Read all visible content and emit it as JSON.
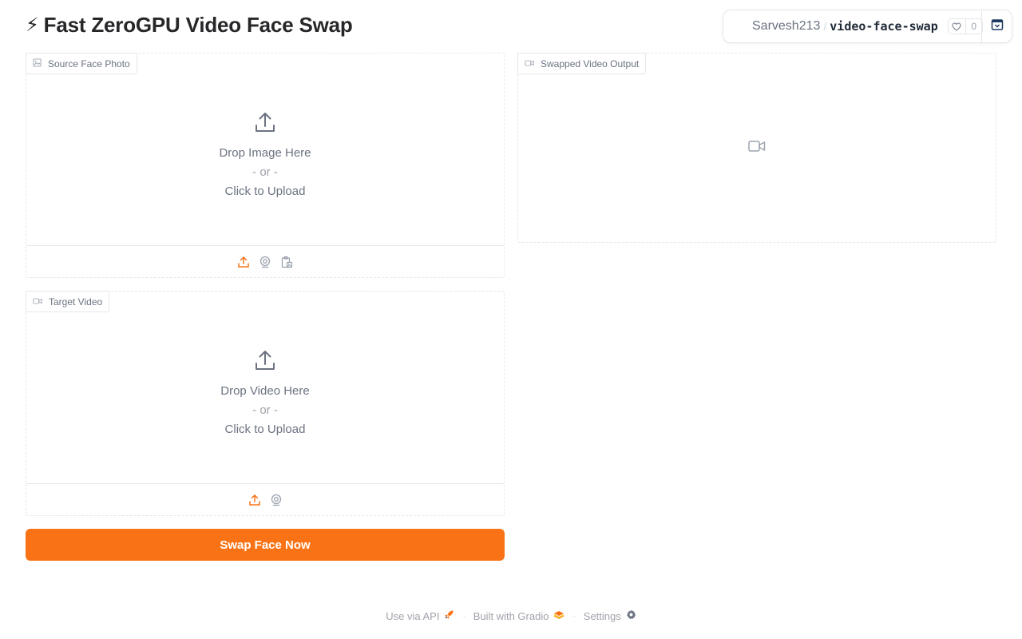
{
  "header": {
    "title_icon": "⚡",
    "title": "Fast ZeroGPU Video Face Swap"
  },
  "hf_badge": {
    "owner": "Sarvesh213",
    "separator": "/",
    "repo": "video-face-swap",
    "like_count": "0"
  },
  "source_panel": {
    "label": "Source Face Photo",
    "drop_text": "Drop Image Here",
    "or_text": "- or -",
    "upload_text": "Click to Upload"
  },
  "target_panel": {
    "label": "Target Video",
    "drop_text": "Drop Video Here",
    "or_text": "- or -",
    "upload_text": "Click to Upload"
  },
  "output_panel": {
    "label": "Swapped Video Output"
  },
  "swap_button": {
    "label": "Swap Face Now"
  },
  "footer": {
    "api": "Use via API",
    "built": "Built with Gradio",
    "settings": "Settings"
  },
  "colors": {
    "accent": "#f97316",
    "border": "#e5e7eb",
    "muted_text": "#6b7280"
  }
}
